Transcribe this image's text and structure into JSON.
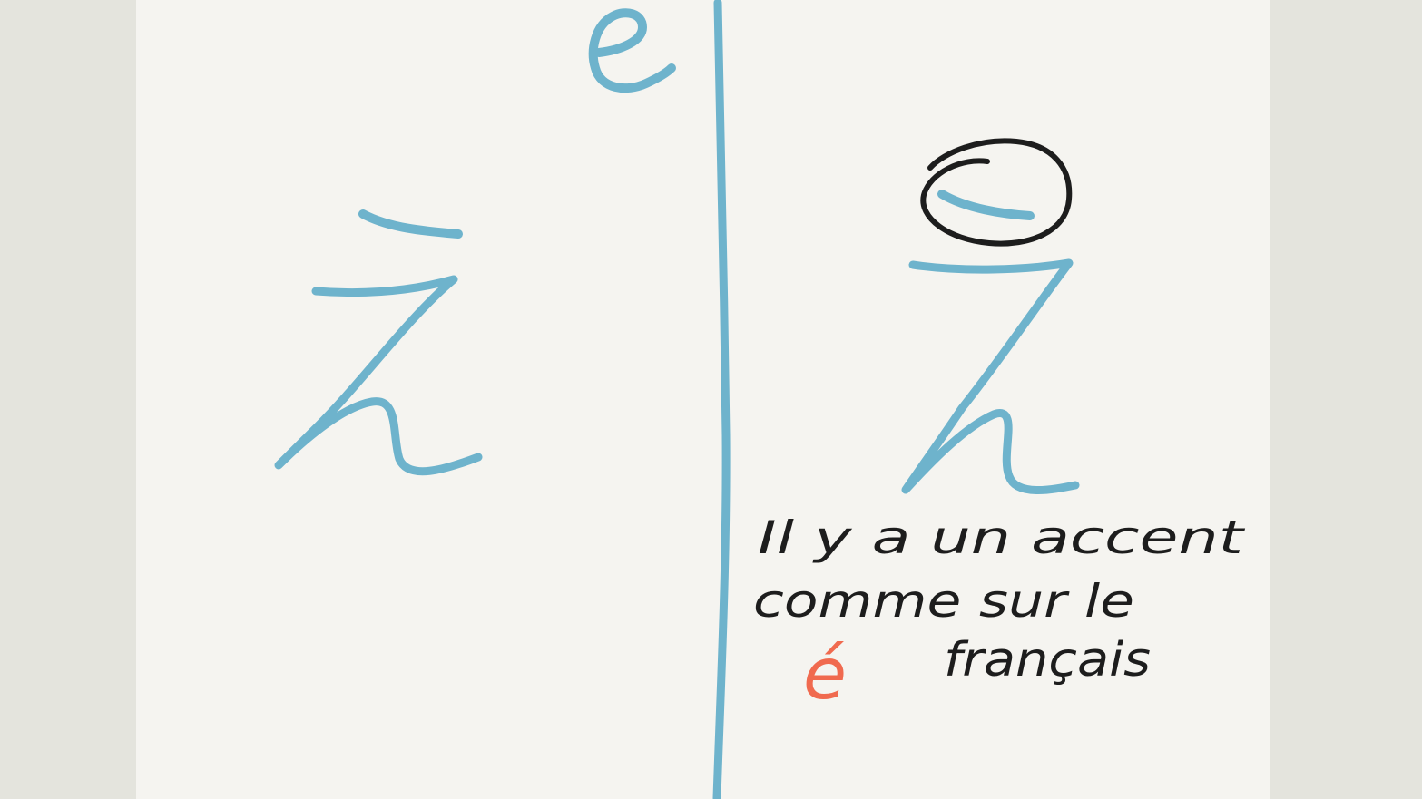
{
  "colors": {
    "page_border": "#e4e4dd",
    "page_background": "#f5f4f0",
    "blue_ink": "#6eb3cc",
    "black_ink": "#1d1d1d",
    "accent_ink": "#f06a4f"
  },
  "letters": {
    "top_letter": "e"
  },
  "note": {
    "line1": "Il y a un accent",
    "line2": "comme sur le",
    "accent_letter": "é",
    "line3_word": "français"
  }
}
